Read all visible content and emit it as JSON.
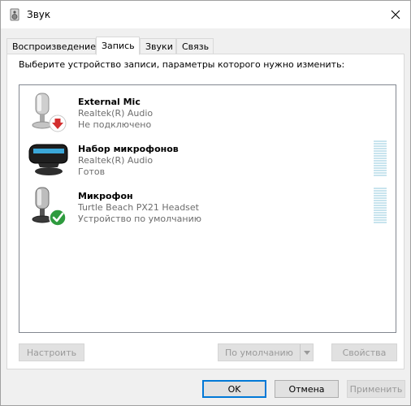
{
  "window": {
    "title": "Звук",
    "title_icon": "speaker-icon",
    "close_icon": "close-icon"
  },
  "tabs": [
    {
      "label": "Воспроизведение",
      "active": false
    },
    {
      "label": "Запись",
      "active": true
    },
    {
      "label": "Звуки",
      "active": false
    },
    {
      "label": "Связь",
      "active": false
    }
  ],
  "panel": {
    "instruction": "Выберите устройство записи, параметры которого нужно изменить:"
  },
  "devices": [
    {
      "name": "External Mic",
      "driver": "Realtek(R) Audio",
      "status": "Не подключено",
      "icon": "microphone-icon",
      "badge": "disconnected-arrow-icon",
      "badge_color": "#d32f2f",
      "level_meter": false
    },
    {
      "name": "Набор микрофонов",
      "driver": "Realtek(R) Audio",
      "status": "Готов",
      "icon": "microphone-array-icon",
      "badge": "",
      "level_meter": true
    },
    {
      "name": "Микрофон",
      "driver": "Turtle Beach PX21 Headset",
      "status": "Устройство по умолчанию",
      "icon": "microphone-icon",
      "badge": "default-checkmark-icon",
      "badge_color": "#2e9b3e",
      "level_meter": true
    }
  ],
  "buttons": {
    "configure": "Настроить",
    "set_default": "По умолчанию",
    "properties": "Свойства",
    "ok": "OK",
    "cancel": "Отмена",
    "apply": "Применить"
  },
  "colors": {
    "accent": "#0078d7",
    "disabled_text": "#9a9a9a",
    "secondary_text": "#6d6d6d",
    "level_meter": "#c8e4ee"
  }
}
